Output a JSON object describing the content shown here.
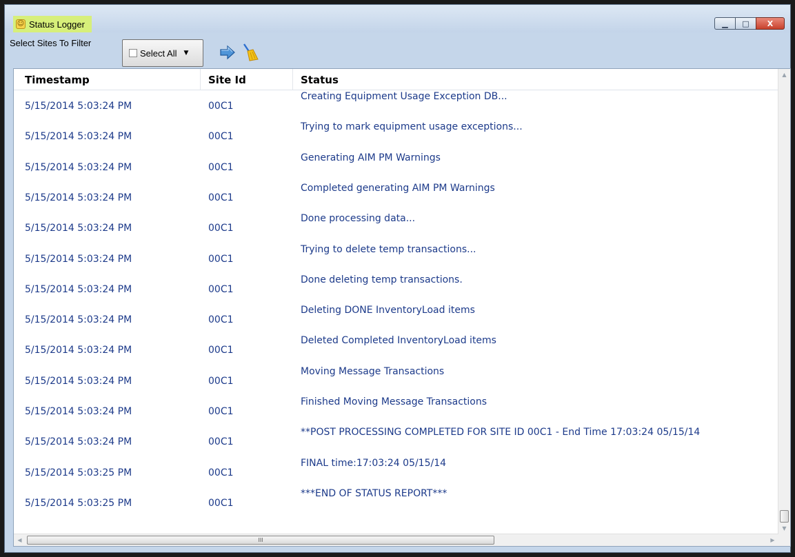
{
  "window": {
    "title": "Status Logger",
    "controls": {
      "minimize": "▁",
      "maximize": "□",
      "close": "X"
    }
  },
  "toolbar": {
    "filter_label": "Select Sites To Filter",
    "select_all_label": "Select All",
    "select_all_checked": false,
    "icons": [
      "forward-arrow-icon",
      "broom-clear-icon"
    ]
  },
  "grid": {
    "columns": [
      "Timestamp",
      "Site Id",
      "Status"
    ],
    "rows": [
      {
        "timestamp": "5/15/2014 5:03:24 PM",
        "site_id": "00C1",
        "status": "Creating Equipment Usage Exception DB..."
      },
      {
        "timestamp": "5/15/2014 5:03:24 PM",
        "site_id": "00C1",
        "status": "Trying to mark equipment usage exceptions..."
      },
      {
        "timestamp": "5/15/2014 5:03:24 PM",
        "site_id": "00C1",
        "status": "Generating AIM PM Warnings"
      },
      {
        "timestamp": "5/15/2014 5:03:24 PM",
        "site_id": "00C1",
        "status": "Completed generating AIM PM Warnings"
      },
      {
        "timestamp": "5/15/2014 5:03:24 PM",
        "site_id": "00C1",
        "status": "Done processing data..."
      },
      {
        "timestamp": "5/15/2014 5:03:24 PM",
        "site_id": "00C1",
        "status": "Trying to delete temp transactions..."
      },
      {
        "timestamp": "5/15/2014 5:03:24 PM",
        "site_id": "00C1",
        "status": "Done deleting temp transactions."
      },
      {
        "timestamp": "5/15/2014 5:03:24 PM",
        "site_id": "00C1",
        "status": "Deleting DONE InventoryLoad items"
      },
      {
        "timestamp": "5/15/2014 5:03:24 PM",
        "site_id": "00C1",
        "status": "Deleted Completed InventoryLoad items"
      },
      {
        "timestamp": "5/15/2014 5:03:24 PM",
        "site_id": "00C1",
        "status": "Moving Message Transactions"
      },
      {
        "timestamp": "5/15/2014 5:03:24 PM",
        "site_id": "00C1",
        "status": "Finished Moving Message Transactions"
      },
      {
        "timestamp": "5/15/2014 5:03:24 PM",
        "site_id": "00C1",
        "status": "**POST PROCESSING COMPLETED FOR SITE ID 00C1 - End Time 17:03:24 05/15/14"
      },
      {
        "timestamp": "5/15/2014 5:03:25 PM",
        "site_id": "00C1",
        "status": "FINAL time:17:03:24 05/15/14"
      },
      {
        "timestamp": "5/15/2014 5:03:25 PM",
        "site_id": "00C1",
        "status": "***END OF STATUS REPORT***"
      }
    ]
  },
  "scrollbars": {
    "vertical": {
      "up": "▲",
      "down": "▼"
    },
    "horizontal": {
      "left": "◀",
      "right": "▶",
      "grip": "III"
    }
  },
  "colors": {
    "row_text": "#1c3a8a",
    "title_highlight": "#d7ef7a",
    "close_button": "#c8412c"
  }
}
